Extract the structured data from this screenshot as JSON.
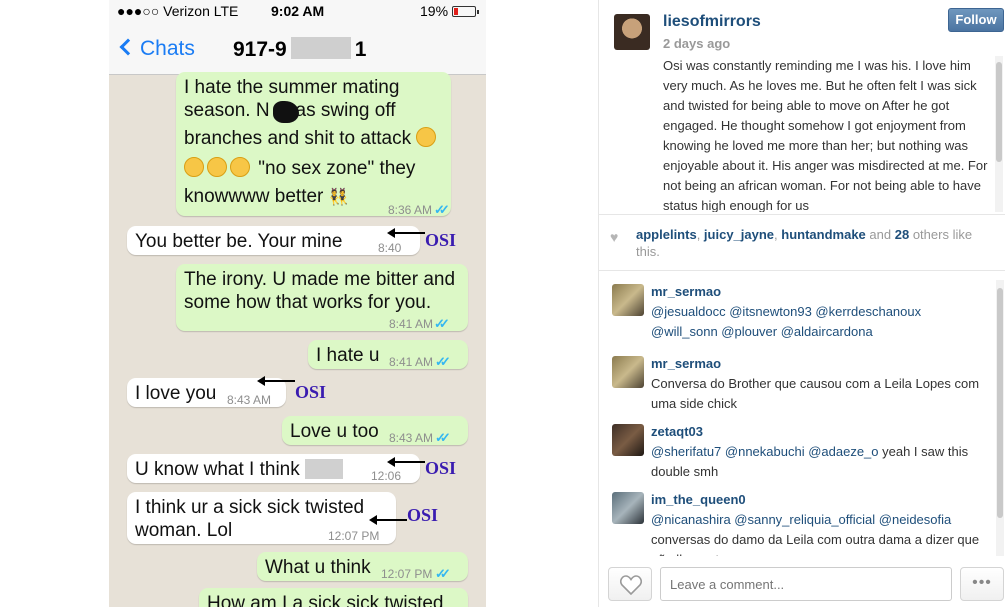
{
  "chat": {
    "status": {
      "carrier": "●●●○○ Verizon  LTE",
      "time": "9:02 AM",
      "battery": "19%",
      "battery_level": 0.19
    },
    "nav": {
      "back_label": "Chats",
      "contact_start": "917-9",
      "contact_end": "1"
    },
    "messages": [
      {
        "dir": "out",
        "text": "I hate the summer mating season. N  as swing off branches and shit to attack",
        "time": "8:36 AM"
      },
      {
        "dir": "out",
        "text": "\"no sex zone\" they knowwww better",
        "time": ""
      },
      {
        "dir": "in",
        "text": "You better be. Your mine",
        "time": "8:40 AM",
        "note": "OSI"
      },
      {
        "dir": "out",
        "text": "The irony. U made me bitter and some how that works for you.",
        "time": "8:41 AM"
      },
      {
        "dir": "out",
        "text": "I hate u",
        "time": "8:41 AM"
      },
      {
        "dir": "in",
        "text": "I love you",
        "time": "8:43 AM",
        "note": "OSI"
      },
      {
        "dir": "out",
        "text": "Love u too",
        "time": "8:43 AM"
      },
      {
        "dir": "in",
        "text": "U know what I think",
        "time": "12:06 PM",
        "note": "OSI"
      },
      {
        "dir": "in",
        "text": "I think ur a sick sick twisted woman. Lol",
        "time": "12:07 PM",
        "note": "OSI"
      },
      {
        "dir": "out",
        "text": "What u think",
        "time": "12:07 PM"
      },
      {
        "dir": "out",
        "text": "How am I a sick sick twisted",
        "time": ""
      }
    ],
    "lines": {
      "m1a": "I hate the summer mating",
      "m1b": "season. N",
      "m1b2": "as swing off",
      "m1c": "branches and shit to attack",
      "m1d": "\"no sex zone\" they",
      "m1e": "knowwww better"
    }
  },
  "instagram": {
    "username": "liesofmirrors",
    "time_ago": "2 days ago",
    "follow_label": "Follow",
    "caption": "Osi was constantly reminding me I was his. I love him very much. As he loves me. But he often felt I was sick and twisted for being able to move on After he got engaged. He thought somehow I got enjoyment from knowing he loved me more than her; but nothing was enjoyable about it. His anger was misdirected at me. For not being an african woman. For not being able to have status high enough for us",
    "likes": {
      "users": [
        "applelints",
        "juicy_jayne",
        "huntandmake"
      ],
      "and": "and",
      "count": "28",
      "suffix": "others like this."
    },
    "comments": [
      {
        "user": "mr_sermao",
        "text": "@jesualdocc @itsnewton93 @kerrdeschanoux @will_sonn @plouver @aldaircardona"
      },
      {
        "user": "mr_sermao",
        "text": "Conversa do Brother que causou com a Leila Lopes com uma side chick"
      },
      {
        "user": "zetaqt03",
        "text_mentions": "@sherifatu7 @nnekabuchi @adaeze_o",
        "text_rest": " yeah I saw this double smh"
      },
      {
        "user": "im_the_queen0",
        "text_mentions": "@nicanashira @sanny_reliquia_official @neidesofia",
        "text_rest": " conversas do damo da Leila com outra dama a dizer que não lhe curte"
      }
    ],
    "comment_placeholder": "Leave a comment...",
    "more_label": "•••"
  },
  "colors": {
    "accent": "#1a7cf4",
    "bubble_out": "#dcf8c6",
    "bubble_in": "#ffffff",
    "osi_label": "#3a1cb0",
    "ig_link": "#1e4e7a"
  }
}
